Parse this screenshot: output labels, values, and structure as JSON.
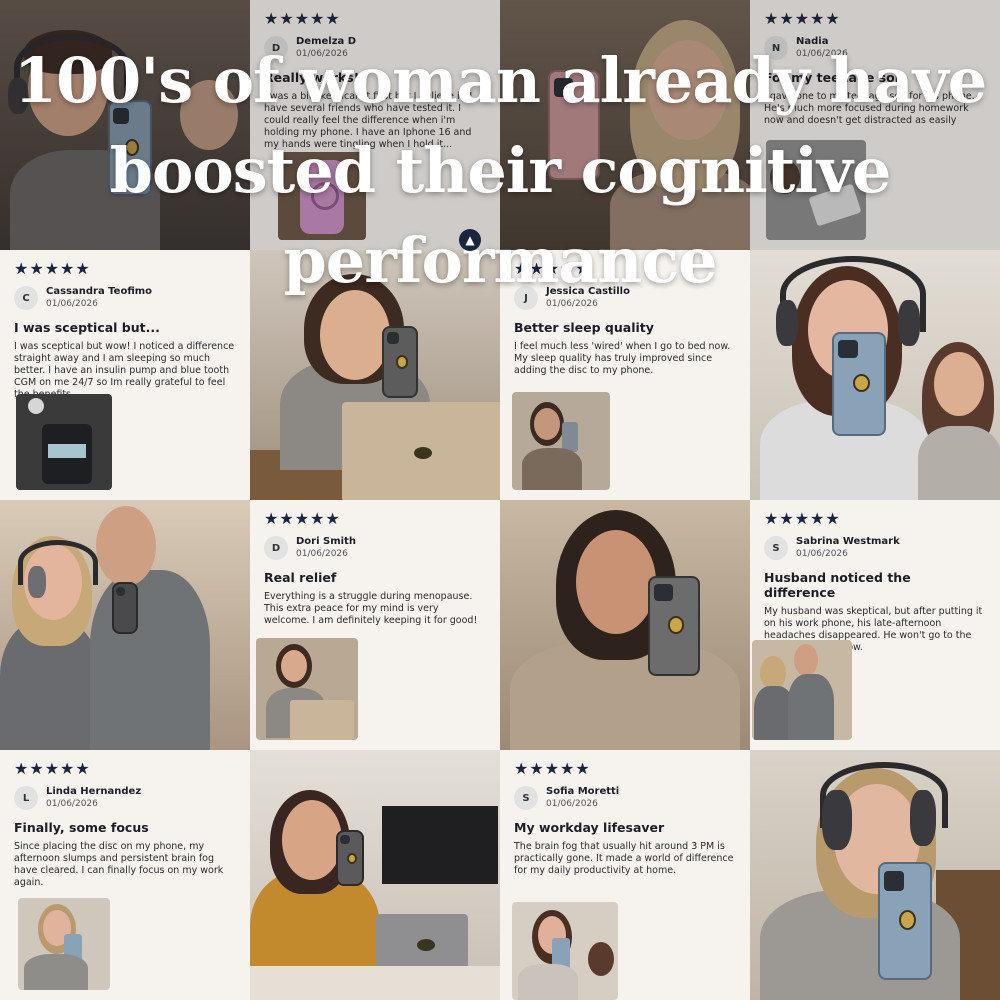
{
  "headline": "100's of woman already have boosted their cognitive performance",
  "stars": "★★★★★",
  "reviews": [
    {
      "initial": "D",
      "name": "Demelza D",
      "date": "01/06/2026",
      "title": "Really works!",
      "body": "I was a bit skeptical at first but I believe it. I have several friends who have tested it. I could really feel the difference when i'm holding my phone. I have an Iphone 16 and my hands were tingling when I hold it..."
    },
    {
      "initial": "N",
      "name": "Nadia",
      "date": "01/06/2026",
      "title": "For my teenage son",
      "body": "I gave one to my teenage son for his phone. He's much more focused during homework now and doesn't get distracted as easily"
    },
    {
      "initial": "C",
      "name": "Cassandra Teofimo",
      "date": "01/06/2026",
      "title": "I was sceptical but...",
      "body": "I was sceptical but wow! I noticed a difference straight away and I am sleeping so much better. I have an insulin pump and blue tooth CGM on me 24/7 so Im really grateful to feel the benefits."
    },
    {
      "initial": "J",
      "name": "Jessica Castillo",
      "date": "01/06/2026",
      "title": "Better sleep quality",
      "body": "I feel much less 'wired' when I go to bed now. My sleep quality has truly improved since adding the disc to my phone."
    },
    {
      "initial": "D",
      "name": "Dori Smith",
      "date": "01/06/2026",
      "title": "Real relief",
      "body": "Everything is a struggle during menopause. This extra peace for my mind is very welcome. I am definitely keeping it for good!"
    },
    {
      "initial": "S",
      "name": "Sabrina Westmark",
      "date": "01/06/2026",
      "title": "Husband noticed the difference",
      "body": "My husband was skeptical, but after putting it on his work phone, his late-afternoon headaches disappeared. He won't go to the office without it now."
    },
    {
      "initial": "L",
      "name": "Linda Hernandez",
      "date": "01/06/2026",
      "title": "Finally, some focus",
      "body": "Since placing the disc on my phone, my afternoon slumps and persistent brain fog have cleared. I can finally focus on my work again."
    },
    {
      "initial": "S",
      "name": "Sofia Moretti",
      "date": "01/06/2026",
      "title": "My workday lifesaver",
      "body": "The brain fog that usually hit around 3 PM is practically gone. It made a world of difference for my daily productivity at home."
    }
  ],
  "icons": {
    "scroll": "chevron-up-icon"
  },
  "colors": {
    "star": "#1b2540",
    "card_bg": "#f6f3ef",
    "disc": "#c9a648"
  }
}
